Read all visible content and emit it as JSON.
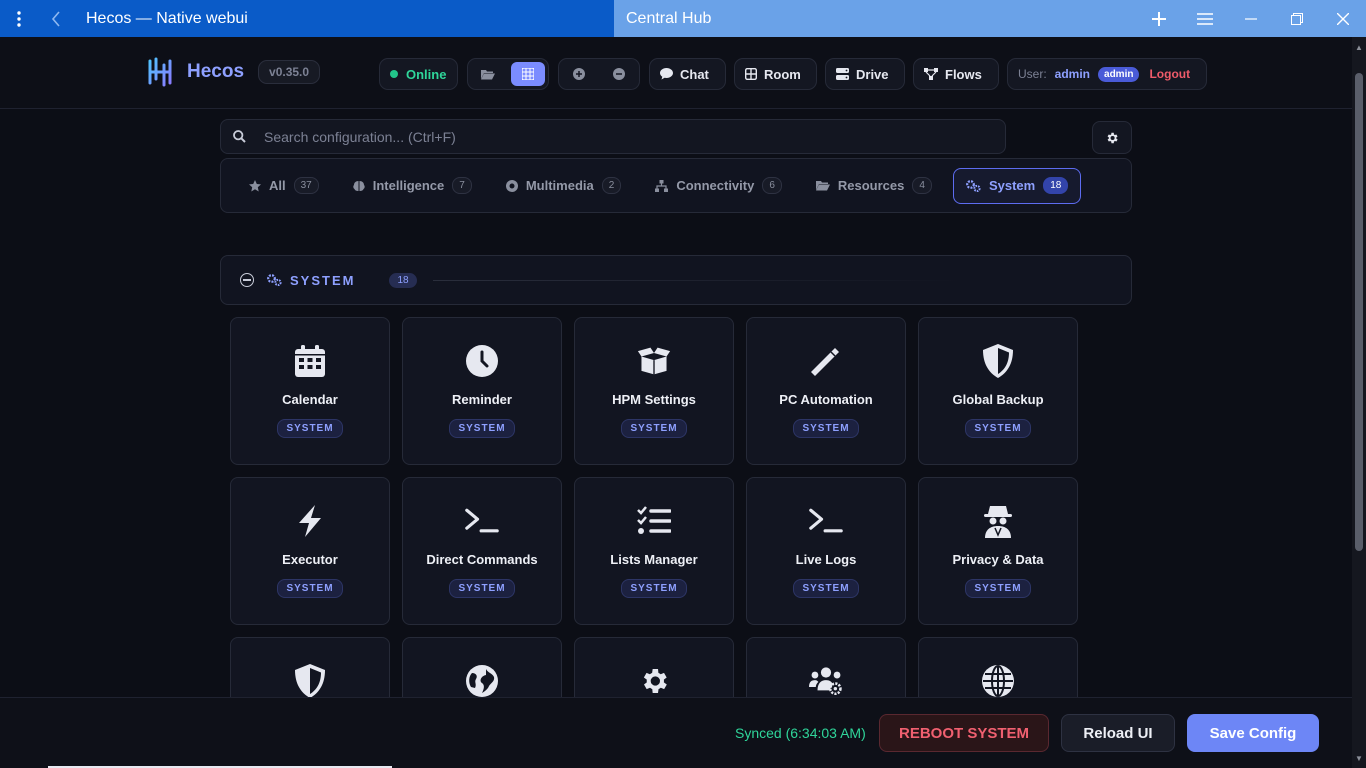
{
  "window": {
    "title": "Hecos — Native webui",
    "tab": "Central Hub"
  },
  "header": {
    "brand": "Hecos",
    "version": "v0.35.0",
    "status": "Online",
    "nav": [
      {
        "label": "Chat",
        "icon": "chat-icon"
      },
      {
        "label": "Room",
        "icon": "room-icon"
      },
      {
        "label": "Drive",
        "icon": "drive-icon"
      },
      {
        "label": "Flows",
        "icon": "flows-icon"
      }
    ],
    "user_label": "User:",
    "user_name": "admin",
    "user_role": "admin",
    "logout": "Logout"
  },
  "search": {
    "placeholder": "Search configuration... (Ctrl+F)"
  },
  "categories": [
    {
      "label": "All",
      "count": "37",
      "icon": "star-icon"
    },
    {
      "label": "Intelligence",
      "count": "7",
      "icon": "brain-icon"
    },
    {
      "label": "Multimedia",
      "count": "2",
      "icon": "record-icon"
    },
    {
      "label": "Connectivity",
      "count": "6",
      "icon": "network-icon"
    },
    {
      "label": "Resources",
      "count": "4",
      "icon": "folder-icon"
    },
    {
      "label": "System",
      "count": "18",
      "icon": "gears-icon",
      "active": true
    }
  ],
  "section": {
    "title": "SYSTEM",
    "count": "18"
  },
  "cards": [
    {
      "name": "Calendar",
      "tag": "SYSTEM",
      "icon": "calendar-icon"
    },
    {
      "name": "Reminder",
      "tag": "SYSTEM",
      "icon": "clock-icon"
    },
    {
      "name": "HPM Settings",
      "tag": "SYSTEM",
      "icon": "box-icon"
    },
    {
      "name": "PC Automation",
      "tag": "SYSTEM",
      "icon": "wand-icon"
    },
    {
      "name": "Global Backup",
      "tag": "SYSTEM",
      "icon": "shield-icon"
    },
    {
      "name": "Executor",
      "tag": "SYSTEM",
      "icon": "bolt-icon"
    },
    {
      "name": "Direct Commands",
      "tag": "SYSTEM",
      "icon": "terminal-icon"
    },
    {
      "name": "Lists Manager",
      "tag": "SYSTEM",
      "icon": "checklist-icon"
    },
    {
      "name": "Live Logs",
      "tag": "SYSTEM",
      "icon": "terminal-icon"
    },
    {
      "name": "Privacy & Data",
      "tag": "SYSTEM",
      "icon": "spy-icon"
    },
    {
      "name": "",
      "tag": "",
      "icon": "shield-icon"
    },
    {
      "name": "",
      "tag": "",
      "icon": "earth-icon"
    },
    {
      "name": "",
      "tag": "",
      "icon": "gear-icon"
    },
    {
      "name": "",
      "tag": "",
      "icon": "users-gear-icon"
    },
    {
      "name": "",
      "tag": "",
      "icon": "globe-icon"
    }
  ],
  "footer": {
    "synced": "Synced (6:34:03 AM)",
    "reboot": "REBOOT SYSTEM",
    "reload": "Reload UI",
    "save": "Save Config"
  },
  "colors": {
    "accent": "#8ea0ff",
    "online": "#2fd59a",
    "danger": "#f06070",
    "primary_btn": "#6d86f6"
  }
}
